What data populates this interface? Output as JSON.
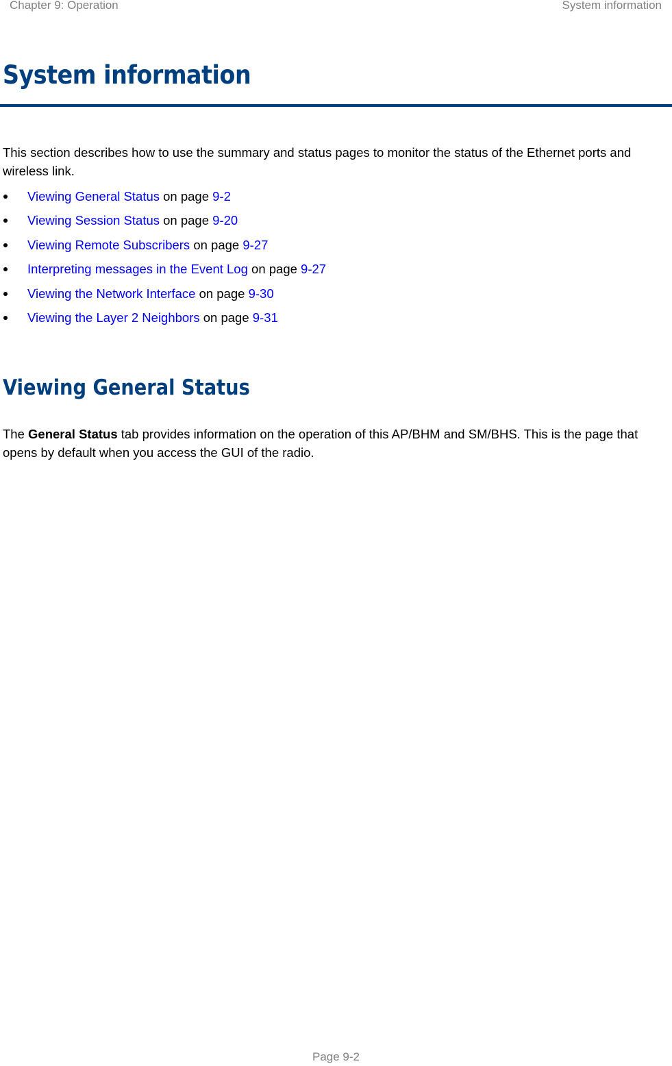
{
  "header": {
    "chapter": "Chapter 9:  Operation",
    "section": "System information"
  },
  "title": "System information",
  "intro": "This section describes how to use the summary and status pages to monitor the status of the Ethernet ports and wireless link.",
  "links": [
    {
      "label": "Viewing General Status",
      "connector": " on page ",
      "page": "9-2"
    },
    {
      "label": "Viewing Session Status",
      "connector": " on page ",
      "page": "9-20"
    },
    {
      "label": "Viewing Remote Subscribers",
      "connector": " on page ",
      "page": "9-27"
    },
    {
      "label": "Interpreting messages in the Event Log",
      "connector": " on page ",
      "page": "9-27"
    },
    {
      "label": "Viewing the Network Interface",
      "connector": " on page ",
      "page": "9-30"
    },
    {
      "label": "Viewing the Layer 2 Neighbors",
      "connector": " on page ",
      "page": "9-31"
    }
  ],
  "subsection": {
    "title": "Viewing General Status",
    "para_prefix": "The ",
    "para_bold": "General Status",
    "para_suffix": " tab provides information on the operation of this AP/BHM and SM/BHS. This is the page that opens by default when you access the GUI of the radio."
  },
  "footer": {
    "page": "Page 9-2"
  },
  "colors": {
    "heading": "#003f7d",
    "link": "#0000ff",
    "header_text": "#808080"
  }
}
